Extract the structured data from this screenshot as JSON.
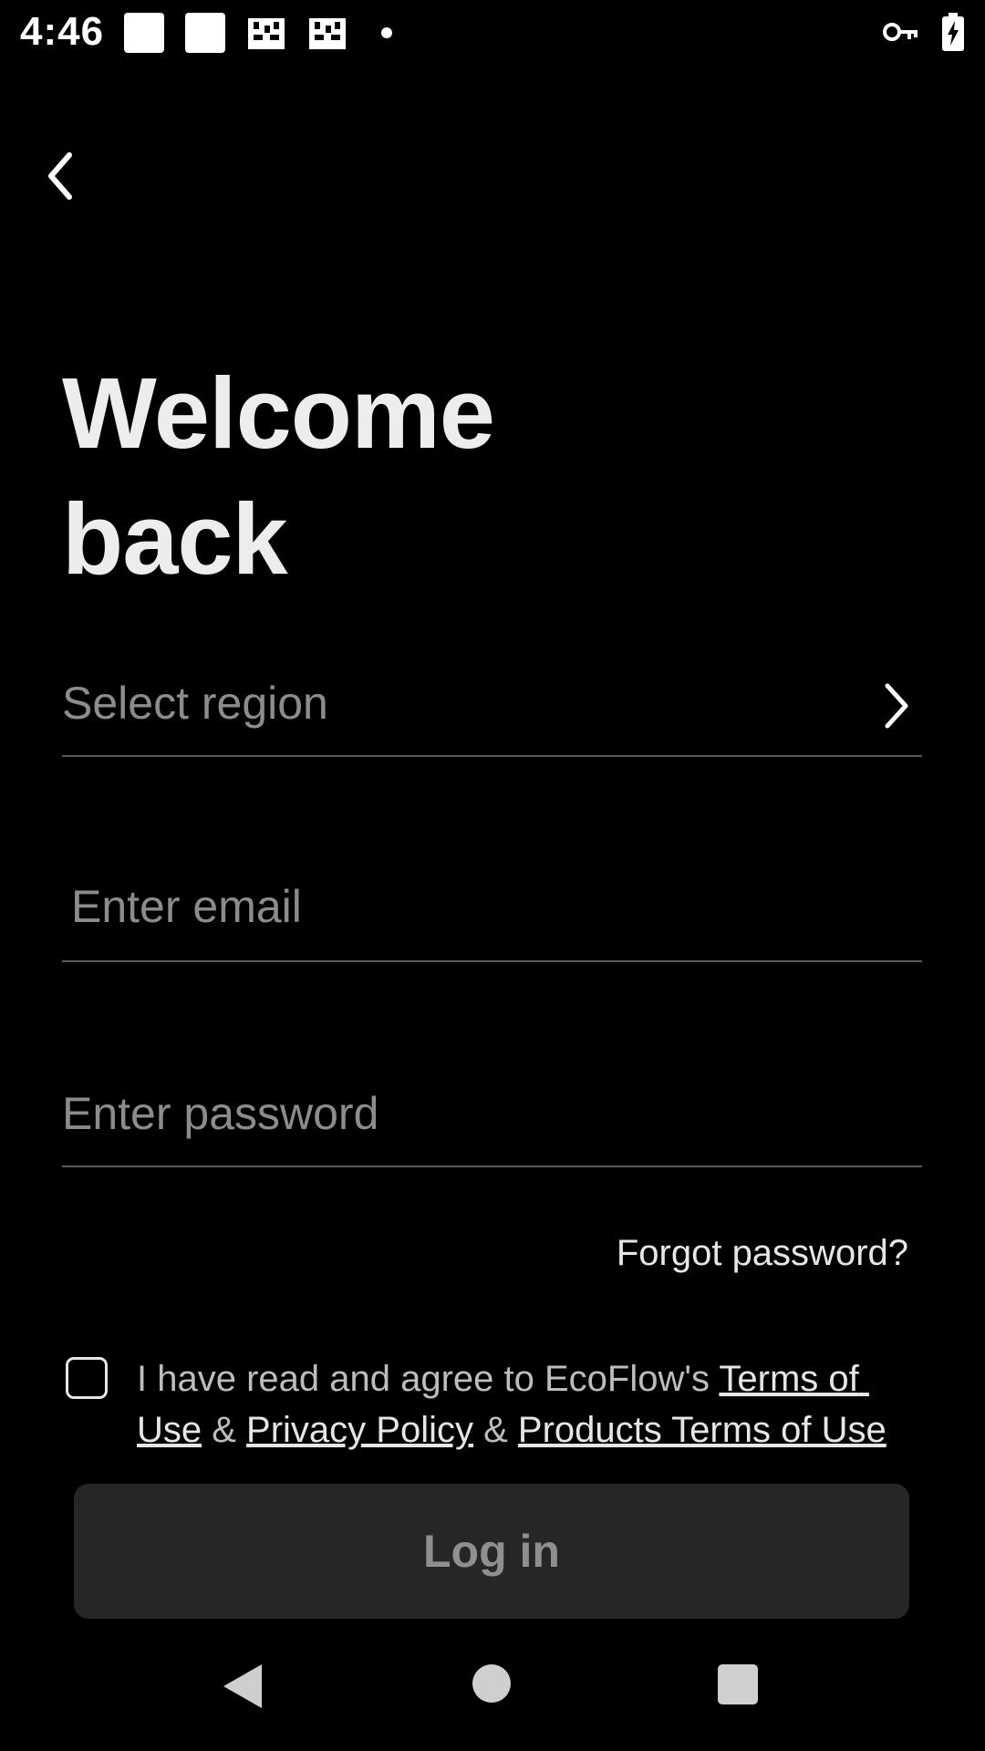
{
  "status_bar": {
    "time": "4:46"
  },
  "header": {
    "back_icon": "chevron-left-icon"
  },
  "title": {
    "line1": "Welcome",
    "line2": "back"
  },
  "form": {
    "region_placeholder": "Select region",
    "email_placeholder": "Enter email",
    "password_placeholder": "Enter password",
    "forgot_label": "Forgot password?"
  },
  "agreement": {
    "prefix": "I have read and agree to EcoFlow's ",
    "terms_label": "Terms of Use",
    "sep1": " & ",
    "privacy_label": "Privacy Policy",
    "sep2": " & ",
    "products_terms_label": "Products Terms of Use",
    "checked": false
  },
  "login": {
    "label": "Log in"
  },
  "colors": {
    "background": "#000000",
    "text_primary": "#ededed",
    "placeholder": "#8c8c8c",
    "divider": "#5a5a5a",
    "button_bg": "#262626",
    "button_text": "#8f8f8f"
  }
}
